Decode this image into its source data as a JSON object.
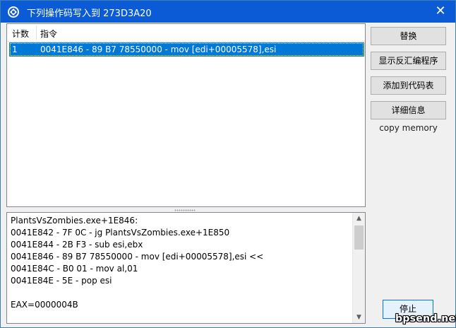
{
  "window": {
    "title": "下列操作码写入到 273D3A20",
    "close_glyph": "✕"
  },
  "list": {
    "headers": [
      "计数",
      "指令"
    ],
    "rows": [
      {
        "count": "1",
        "instruction": "0041E846 - 89 B7 78550000  - mov [edi+00005578],esi"
      }
    ]
  },
  "buttons": {
    "replace": "替换",
    "show_disassembler": "显示反汇编程序",
    "add_to_codelist": "添加到代码表",
    "more_info": "详细信息",
    "copy_memory": "copy memory",
    "stop": "停止"
  },
  "disasm": {
    "lines": [
      "PlantsVsZombies.exe+1E846:",
      "0041E842 - 7F 0C - jg PlantsVsZombies.exe+1E850",
      "0041E844 - 2B F3  - sub esi,ebx",
      "0041E846 - 89 B7 78550000  - mov [edi+00005578],esi <<",
      "0041E84C - B0 01 - mov al,01",
      "0041E84E - 5E - pop esi",
      "",
      "EAX=0000004B"
    ]
  },
  "watermark": "bpsend.net",
  "colors": {
    "titlebar": "#0b5bd7",
    "selection": "#0078d7"
  }
}
